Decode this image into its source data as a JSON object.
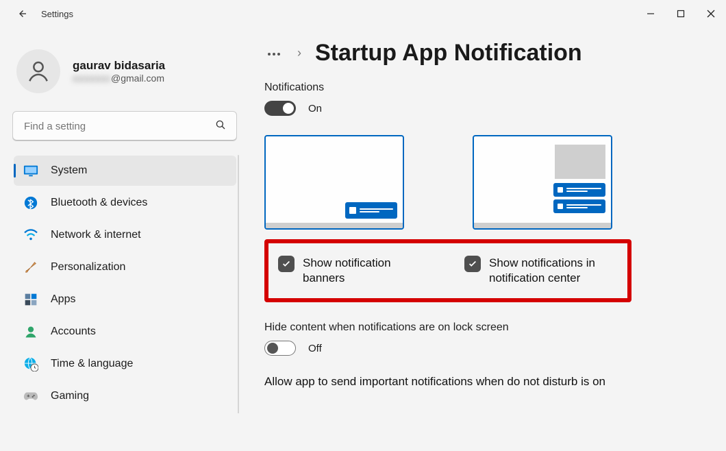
{
  "app_title": "Settings",
  "window_controls": {
    "minimize": "—",
    "maximize": "▢",
    "close": "✕"
  },
  "profile": {
    "name": "gaurav bidasaria",
    "email_visible_suffix": "@gmail.com"
  },
  "search": {
    "placeholder": "Find a setting"
  },
  "sidebar": {
    "items": [
      {
        "label": "System"
      },
      {
        "label": "Bluetooth & devices"
      },
      {
        "label": "Network & internet"
      },
      {
        "label": "Personalization"
      },
      {
        "label": "Apps"
      },
      {
        "label": "Accounts"
      },
      {
        "label": "Time & language"
      },
      {
        "label": "Gaming"
      }
    ]
  },
  "breadcrumb": {
    "page_title": "Startup App Notification"
  },
  "main": {
    "notifications_label": "Notifications",
    "notifications_state": "On",
    "check1_label": "Show notification banners",
    "check2_label": "Show notifications in notification center",
    "hide_content_label": "Hide content when notifications are on lock screen",
    "hide_content_state": "Off",
    "important_label": "Allow app to send important notifications when do not disturb is on"
  }
}
